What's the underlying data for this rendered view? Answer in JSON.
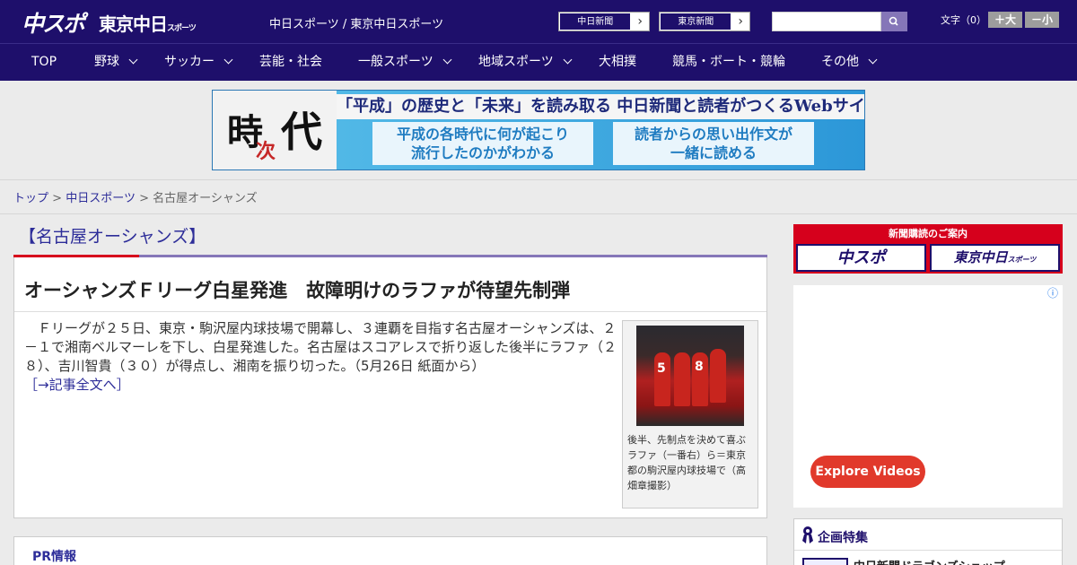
{
  "header": {
    "logo_chuspo": "中スポ",
    "logo_tokyo": "東京中日",
    "logo_tokyo_small": "スポーツ",
    "site_links": "中日スポーツ / 東京中日スポーツ",
    "newspaper_buttons": [
      {
        "label": "中日新聞",
        "arrow": "›"
      },
      {
        "label": "東京新聞",
        "arrow": "›"
      }
    ],
    "search": {
      "placeholder": "",
      "icon": "search-icon"
    },
    "font_size_label": "文字（0）",
    "font_larger": "＋大",
    "font_smaller": "－小"
  },
  "nav": {
    "items": [
      {
        "label": "TOP",
        "dropdown": false
      },
      {
        "label": "野球",
        "dropdown": true
      },
      {
        "label": "サッカー",
        "dropdown": true
      },
      {
        "label": "芸能・社会",
        "dropdown": false
      },
      {
        "label": "一般スポーツ",
        "dropdown": true
      },
      {
        "label": "地域スポーツ",
        "dropdown": true
      },
      {
        "label": "大相撲",
        "dropdown": false
      },
      {
        "label": "競馬・ボート・競輪",
        "dropdown": false
      },
      {
        "label": "その他",
        "dropdown": true
      }
    ]
  },
  "banner": {
    "kanji_1": "時",
    "kanji_2": "次",
    "kanji_3": "代",
    "headline": "「平成」の歴史と「未来」を読み取る 中日新聞と読者がつくるWebサイト",
    "box_left_line1": "平成の各時代に何が起こり",
    "box_left_line2": "流行したのかがわかる",
    "box_right_line1": "読者からの思い出作文が",
    "box_right_line2": "一緒に読める"
  },
  "breadcrumb": {
    "home": "トップ",
    "section": "中日スポーツ",
    "current": "名古屋オーシャンズ",
    "separator": ">"
  },
  "category": {
    "title": "【名古屋オーシャンズ】"
  },
  "article": {
    "title": "オーシャンズＦリーグ白星発進　故障明けのラファが待望先制弾",
    "body": "　Ｆリーグが２５日、東京・駒沢屋内球技場で開幕し、３連覇を目指す名古屋オーシャンズは、２－１で湘南ベルマーレを下し、白星発進した。名古屋はスコアレスで折り返した後半にラファ（２８）、吉川智貴（３０）が得点し、湘南を振り切った。（5月26日 紙面から）",
    "more_link": "［→記事全文へ］",
    "photo_numbers": [
      "5",
      "8"
    ],
    "photo_caption": "後半、先制点を決めて喜ぶラファ（一番右）ら＝東京都の駒沢屋内球技場で（高畑章撮影）"
  },
  "pr": {
    "title": "PR情報"
  },
  "sidebar": {
    "subscription_title": "新聞購読のご案内",
    "subscription_buttons": [
      "中スポ",
      "東京中日"
    ],
    "subscription_small": "スポーツ",
    "ad_button": "Explore Videos",
    "ad_info_icon": "ⓘ",
    "special_title": "企画特集",
    "special_item": "中日新聞ドラゴンズショップ"
  },
  "colors": {
    "header_bg": "#1e0f6b",
    "accent_red": "#d6001c",
    "accent_purple": "#8576b8",
    "link_blue": "#2d2d99"
  }
}
